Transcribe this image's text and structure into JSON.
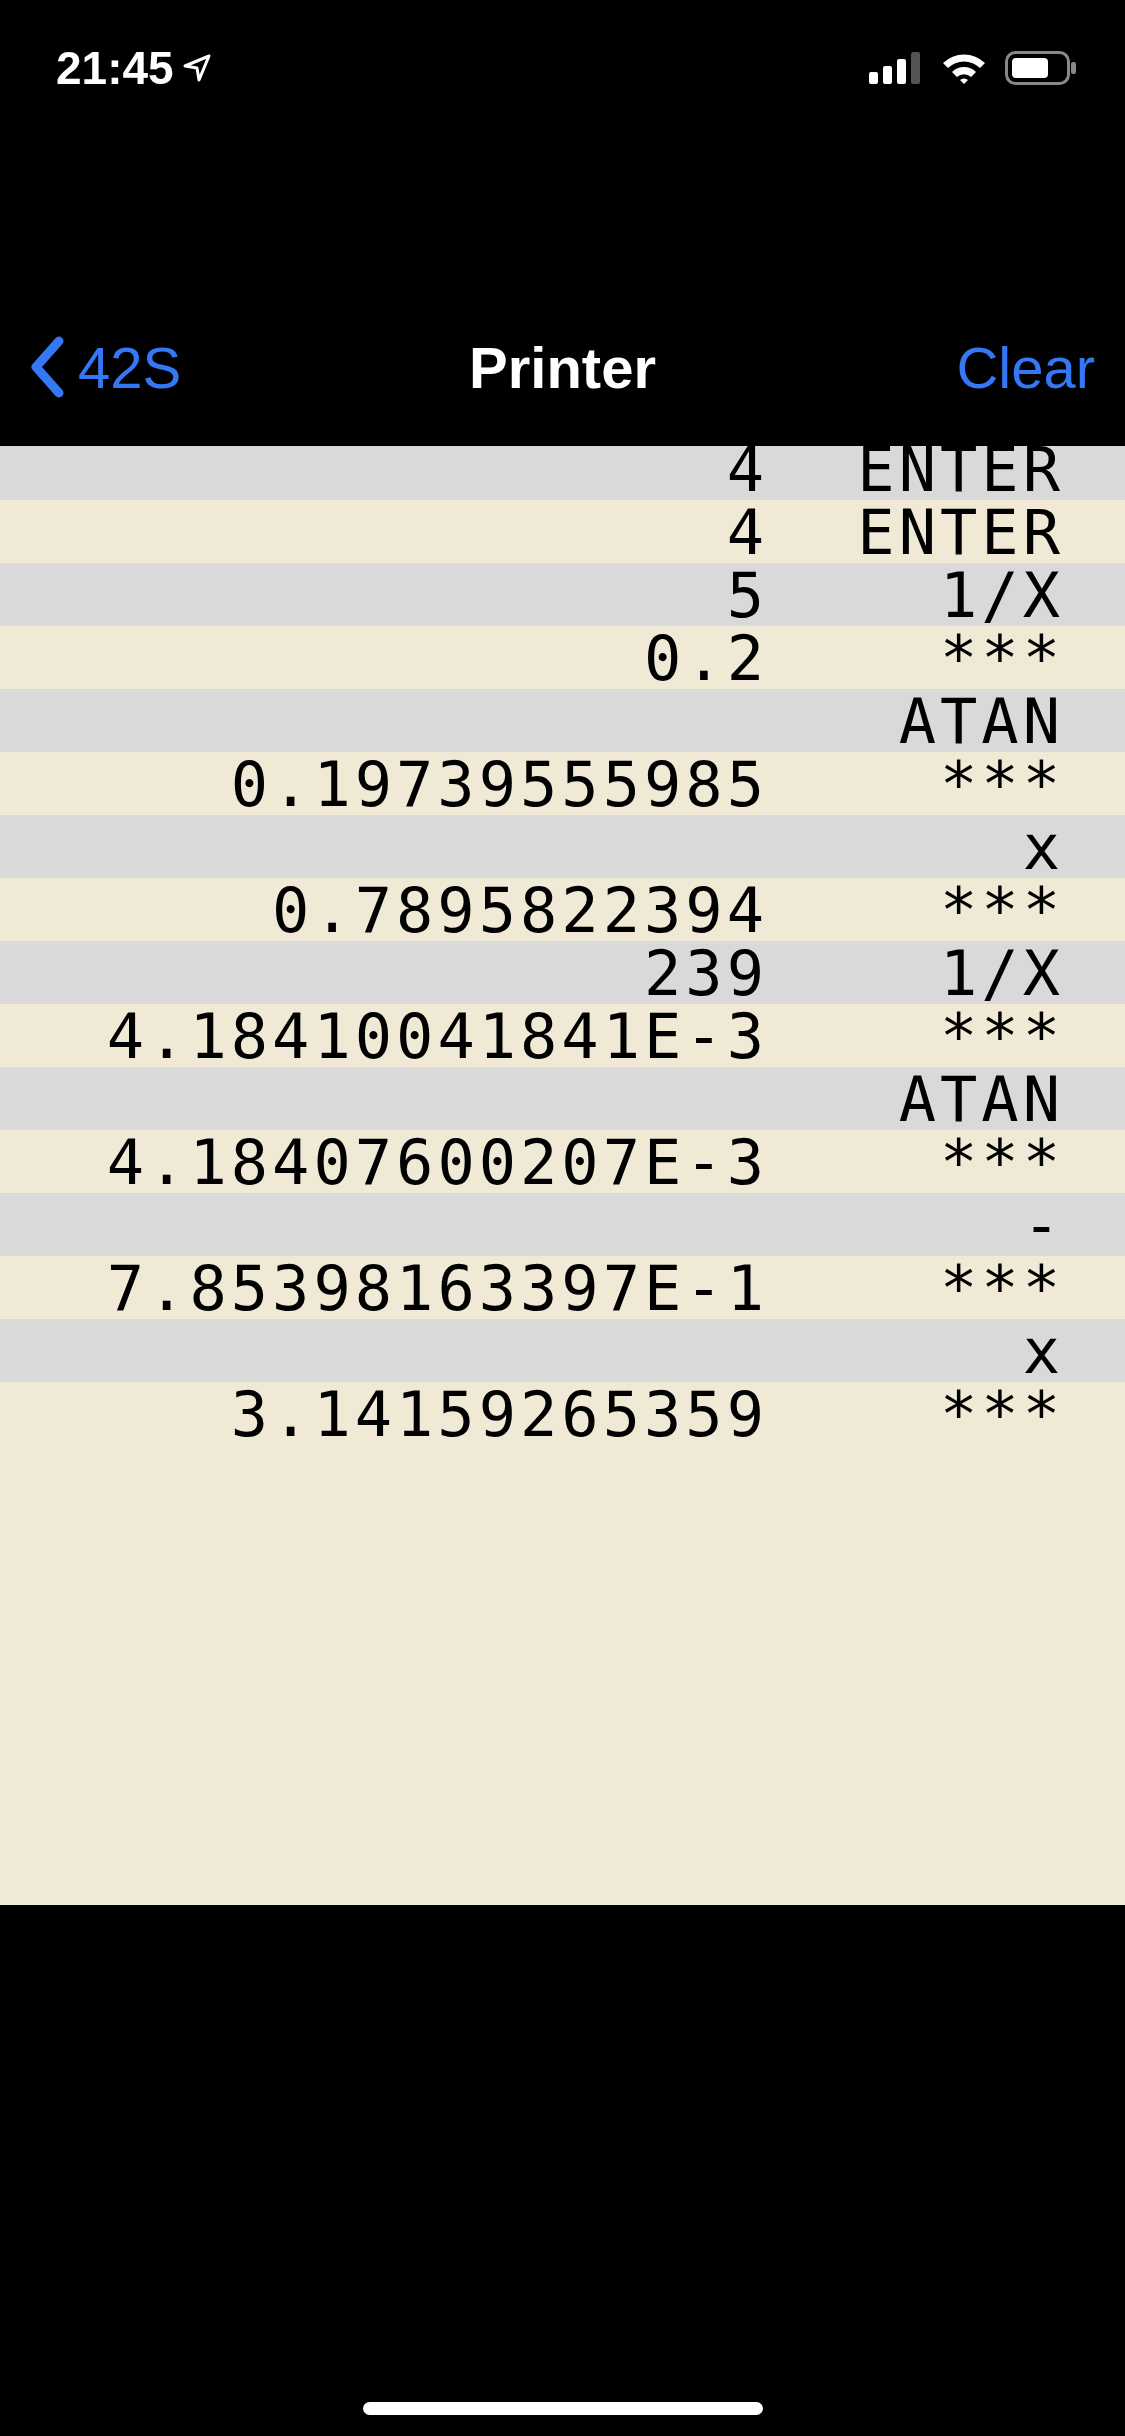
{
  "status_bar": {
    "time": "21:45"
  },
  "nav_bar": {
    "back": "42S",
    "title": "Printer",
    "action": "Clear"
  },
  "printout": [
    {
      "value": "4",
      "op": "ENTER"
    },
    {
      "value": "4",
      "op": "ENTER"
    },
    {
      "value": "5",
      "op": "1/X"
    },
    {
      "value": "0.2",
      "op": "***"
    },
    {
      "op": "ATAN"
    },
    {
      "value": "0.19739555985",
      "op": "***"
    },
    {
      "op": "x"
    },
    {
      "value": "0.7895822394",
      "op": "***"
    },
    {
      "value": "239",
      "op": "1/X"
    },
    {
      "value": "4.18410041841E-3",
      "op": "***"
    },
    {
      "op": "ATAN"
    },
    {
      "value": "4.18407600207E-3",
      "op": "***"
    },
    {
      "op": "-"
    },
    {
      "value": "7.85398163397E-1",
      "op": "***"
    },
    {
      "op": "x"
    },
    {
      "value": "3.14159265359",
      "op": "***"
    }
  ]
}
